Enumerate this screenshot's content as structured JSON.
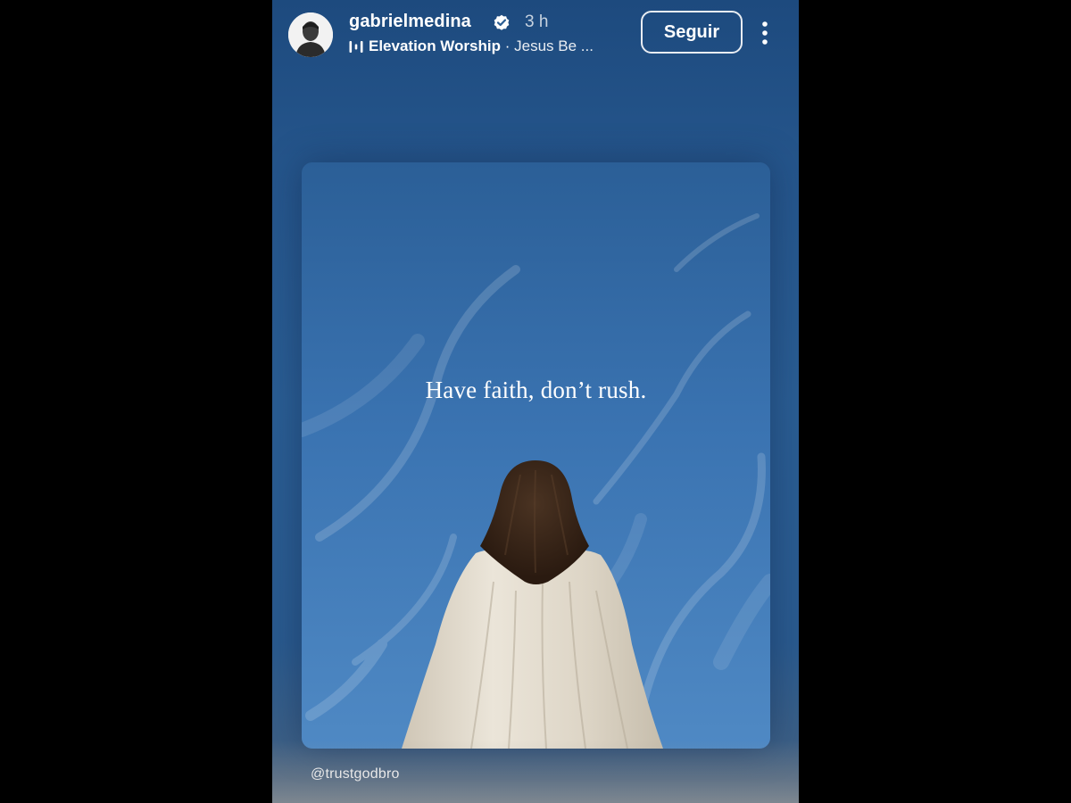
{
  "story": {
    "username": "gabrielmedina",
    "verified": true,
    "time_ago": "3 h",
    "music": {
      "artist": "Elevation Worship",
      "separator": " · ",
      "song": "Jesus Be ..."
    },
    "follow_label": "Seguir",
    "post": {
      "caption": "Have faith, don’t rush."
    },
    "mention": "@trustgodbro"
  },
  "colors": {
    "background": "#000000",
    "story_background": "#2a5d93",
    "sky_top": "#2b5f97",
    "sky_bottom": "#4a82be",
    "robe": "#e4ddd0",
    "hair": "#3a2718",
    "text": "#ffffff",
    "verified_badge": "#ffffff"
  },
  "icons": {
    "avatar": "profile-photo",
    "verified": "verified-badge-icon",
    "music": "music-bars-icon",
    "more": "more-vertical-icon"
  }
}
